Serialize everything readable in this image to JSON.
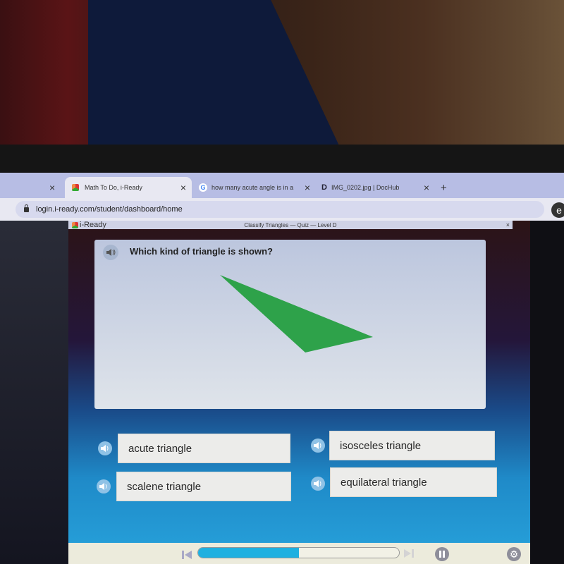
{
  "browser": {
    "tabs": [
      {
        "label": "",
        "active": false
      },
      {
        "label": "Math To Do, i-Ready",
        "active": true,
        "favicon": "iready-cube-icon"
      },
      {
        "label": "how many acute angle is in a",
        "active": false,
        "favicon": "google-g-icon"
      },
      {
        "label": "IMG_0202.jpg | DocHub",
        "active": false,
        "favicon": "dochub-d-icon"
      }
    ],
    "new_tab_label": "+",
    "close_glyph": "×",
    "favicon_glyphs": {
      "google": "G",
      "dochub": "D"
    },
    "url": "login.i-ready.com/student/dashboard/home",
    "profile_initial": "e"
  },
  "app": {
    "logo_text": "i-Ready",
    "title": "Classify Triangles — Quiz — Level D",
    "close_glyph": "×",
    "question": "Which kind of triangle is shown?",
    "figure": {
      "shape": "triangle",
      "color": "#2ea24a",
      "classification_hint": "obtuse-looking scalene"
    },
    "choices": [
      {
        "label": "acute triangle"
      },
      {
        "label": "isosceles triangle"
      },
      {
        "label": "scalene triangle"
      },
      {
        "label": "equilateral triangle"
      }
    ],
    "player": {
      "progress": 0.5,
      "settings_glyph": "⚙"
    }
  },
  "colors": {
    "accent": "#1fb0e0",
    "triangle": "#2ea24a",
    "tab_bar": "#b7bde4"
  }
}
